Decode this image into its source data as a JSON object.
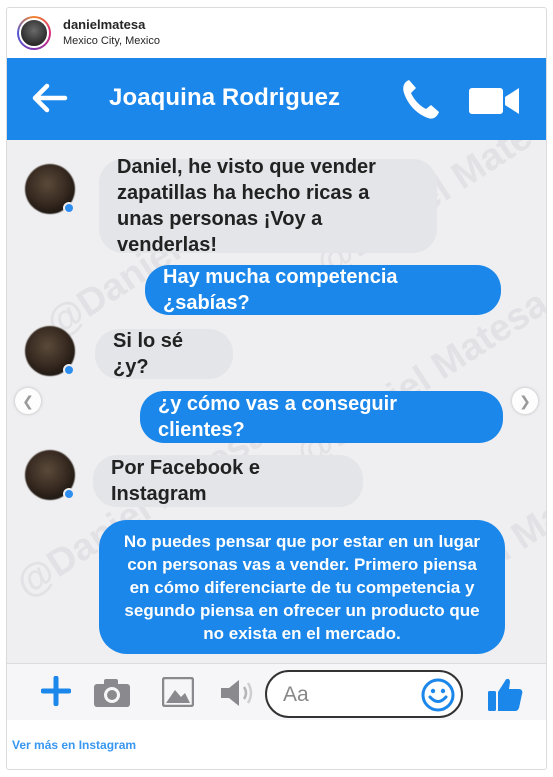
{
  "post": {
    "username": "danielmatesa",
    "location": "Mexico City, Mexico",
    "footer_link": "Ver más en Instagram"
  },
  "chat": {
    "contact_name": "Joaquina Rodriguez",
    "messages": [
      {
        "side": "in",
        "text": "Daniel, he visto que vender zapatillas ha hecho ricas a unas personas ¡Voy a venderlas!"
      },
      {
        "side": "out",
        "text": "Hay mucha competencia ¿sabías?"
      },
      {
        "side": "in",
        "text": "Si lo sé ¿y?"
      },
      {
        "side": "out",
        "text": "¿y cómo vas a conseguir clientes?"
      },
      {
        "side": "in",
        "text": "Por Facebook e Instagram"
      },
      {
        "side": "out",
        "text": "No puedes pensar que por estar en un lugar con personas vas a vender. Primero piensa en cómo diferenciarte de tu competencia y segundo piensa en ofrecer un producto que no exista en el mercado."
      }
    ],
    "composer_placeholder": "Aa",
    "watermark": "@Daniel Matesa"
  },
  "colors": {
    "messenger_blue": "#1c87ea",
    "incoming_bubble": "#e4e5e9",
    "link_blue": "#3897f0"
  },
  "icons": [
    "back-arrow-icon",
    "phone-icon",
    "video-camera-icon",
    "plus-icon",
    "camera-icon",
    "photo-icon",
    "microphone-icon",
    "emoji-icon",
    "thumbs-up-icon"
  ]
}
